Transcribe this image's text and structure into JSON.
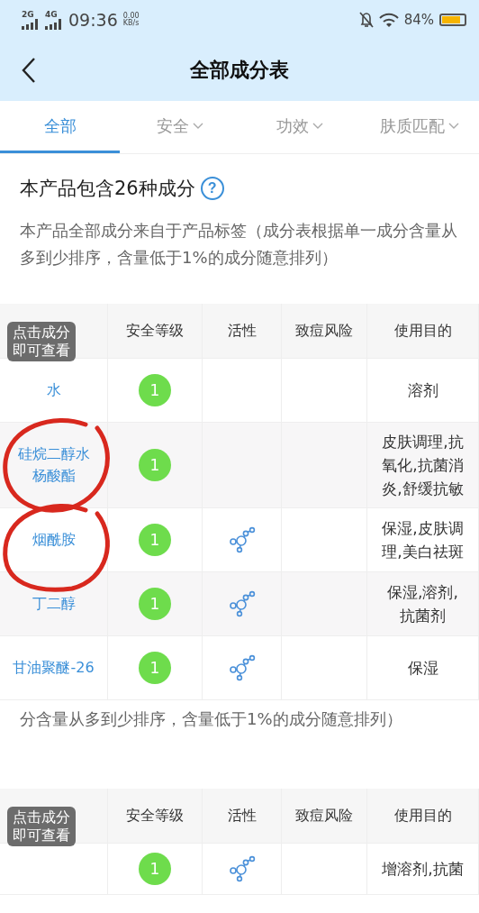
{
  "status_bar": {
    "network_1": "2G",
    "network_2": "4G",
    "time": "09:36",
    "speed": "0.00",
    "speed_unit": "KB/s",
    "battery": "84%"
  },
  "header": {
    "title": "全部成分表"
  },
  "tabs": [
    {
      "label": "全部",
      "selected": true,
      "dropdown": false
    },
    {
      "label": "安全",
      "selected": false,
      "dropdown": true
    },
    {
      "label": "功效",
      "selected": false,
      "dropdown": true
    },
    {
      "label": "肤质匹配",
      "selected": false,
      "dropdown": true
    }
  ],
  "summary": {
    "title": "本产品包含26种成分",
    "help": "?",
    "description": "本产品全部成分来自于产品标签（成分表根据单一成分含量从多到少排序，含量低于1%的成分随意排列）"
  },
  "table": {
    "columns": [
      null,
      "安全等级",
      "活性",
      "致痘风险",
      "使用目的"
    ],
    "tooltip": [
      "点击成分",
      "即可查看"
    ],
    "rows": [
      {
        "name": "水",
        "level": "1",
        "active": false,
        "purpose": "溶剂",
        "circled": false
      },
      {
        "name": "硅烷二醇水杨酸酯",
        "level": "1",
        "active": false,
        "purpose": "皮肤调理,抗氧化,抗菌消炎,舒缓抗敏",
        "circled": true
      },
      {
        "name": "烟酰胺",
        "level": "1",
        "active": true,
        "purpose": "保湿,皮肤调理,美白祛斑",
        "circled": true
      },
      {
        "name": "丁二醇",
        "level": "1",
        "active": true,
        "purpose": "保湿,溶剂,抗菌剂",
        "circled": false
      },
      {
        "name": "甘油聚醚-26",
        "level": "1",
        "active": true,
        "purpose": "保湿",
        "circled": false
      }
    ]
  },
  "repeated_text": "分含量从多到少排序，含量低于1%的成分随意排列）",
  "table_2": {
    "columns": [
      null,
      "安全等级",
      "活性",
      "致痘风险",
      "使用目的"
    ],
    "tooltip": [
      "点击成分",
      "即可查看"
    ],
    "rows": [
      {
        "level": "1",
        "active": true,
        "purpose": "增溶剂,抗菌"
      }
    ]
  }
}
